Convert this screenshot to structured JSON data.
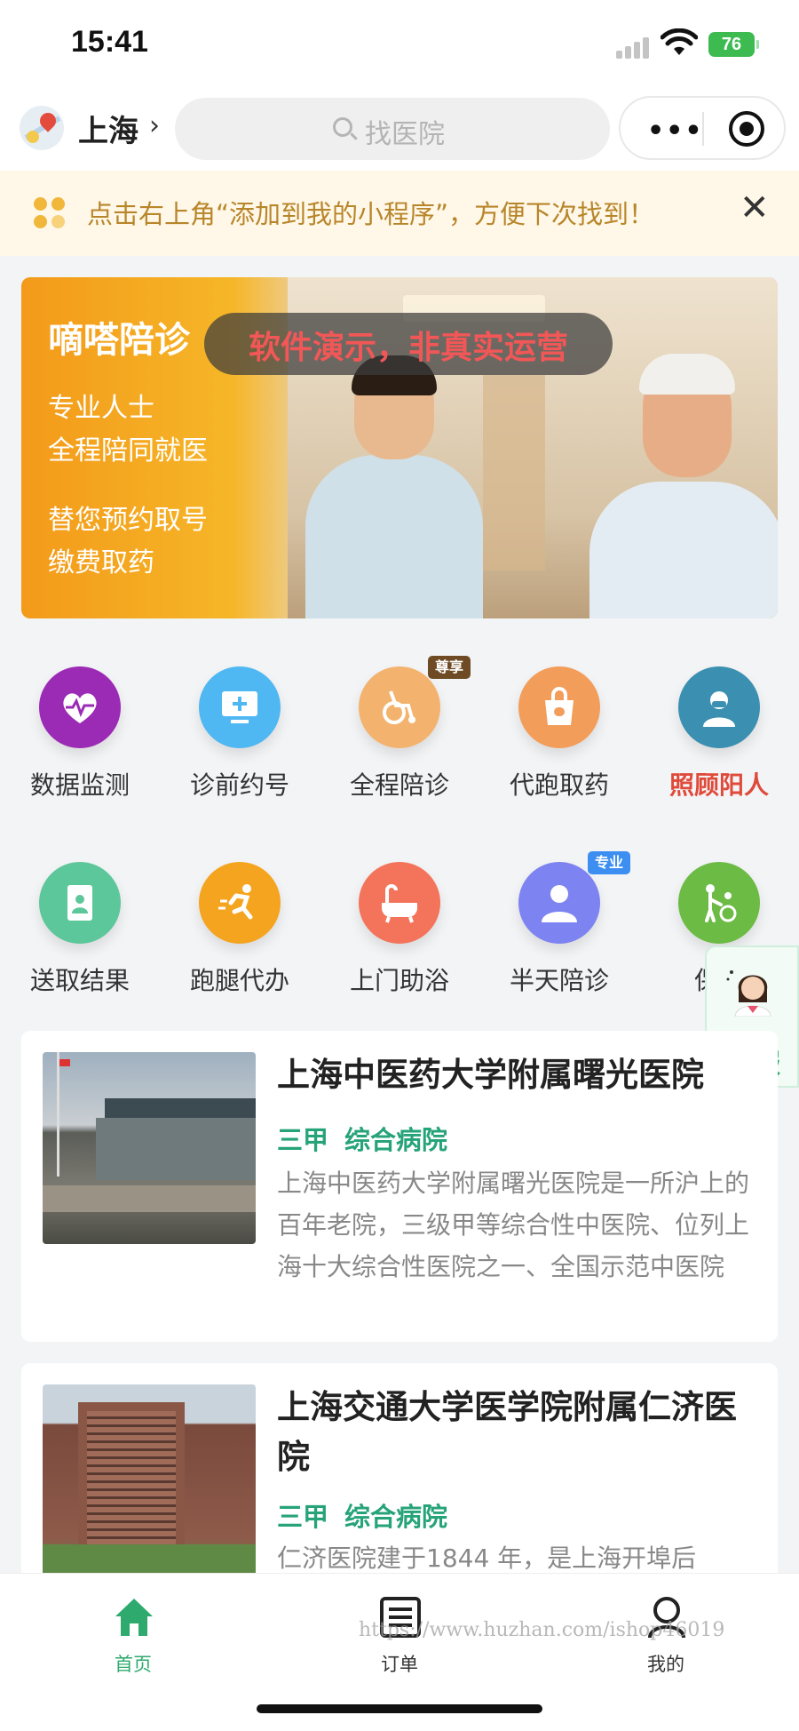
{
  "status": {
    "time": "15:41",
    "battery": "76"
  },
  "nav": {
    "city": "上海",
    "search_placeholder": "找医院"
  },
  "tip": {
    "text": "点击右上角“添加到我的小程序”，方便下次找到！"
  },
  "banner": {
    "title": "嘀嗒陪诊",
    "lines": [
      "专业人士",
      "全程陪同就医",
      "替您预约取号",
      "缴费取药"
    ],
    "watermark": "软件演示，非真实运营"
  },
  "services": [
    {
      "label": "数据监测",
      "icon": "heart-pulse-icon",
      "color": "#9b2ab5"
    },
    {
      "label": "诊前约号",
      "icon": "monitor-plus-icon",
      "color": "#4fb7f2"
    },
    {
      "label": "全程陪诊",
      "icon": "wheelchair-icon",
      "color": "#f3b36e",
      "badge": "尊享"
    },
    {
      "label": "代跑取药",
      "icon": "medicine-bag-icon",
      "color": "#f29d5a"
    },
    {
      "label": "照顾阳人",
      "icon": "nurse-icon",
      "color": "#3b8fb0",
      "highlight": true
    },
    {
      "label": "送取结果",
      "icon": "document-icon",
      "color": "#5cc79a"
    },
    {
      "label": "跑腿代办",
      "icon": "running-icon",
      "color": "#f4a41e"
    },
    {
      "label": "上门助浴",
      "icon": "bathtub-icon",
      "color": "#f3745a"
    },
    {
      "label": "半天陪诊",
      "icon": "person-icon",
      "color": "#7d83f0",
      "badge": "专业"
    },
    {
      "label": "保姆",
      "icon": "caregiver-icon",
      "color": "#6cbb45"
    }
  ],
  "kefu": {
    "label": "客服"
  },
  "hospitals": [
    {
      "name": "上海中医药大学附属曙光医院",
      "tags": [
        "三甲",
        "综合病院"
      ],
      "desc": "上海中医药大学附属曙光医院是一所沪上的百年老院，三级甲等综合性中医院、位列上海十大综合性医院之一、全国示范中医院"
    },
    {
      "name": "上海交通大学医学院附属仁济医院",
      "tags": [
        "三甲",
        "综合病院"
      ],
      "desc": "仁济医院建于1844 年，是上海开埠后"
    }
  ],
  "tabs": [
    {
      "label": "首页",
      "icon": "home-icon",
      "active": true
    },
    {
      "label": "订单",
      "icon": "orders-icon",
      "active": false
    },
    {
      "label": "我的",
      "icon": "profile-icon",
      "active": false
    }
  ],
  "watermark_url": "https://www.huzhan.com/ishop46019",
  "colors": {
    "brand_green": "#2eaa6e",
    "tip_text": "#b8862a",
    "highlight_red": "#e04a3a"
  }
}
